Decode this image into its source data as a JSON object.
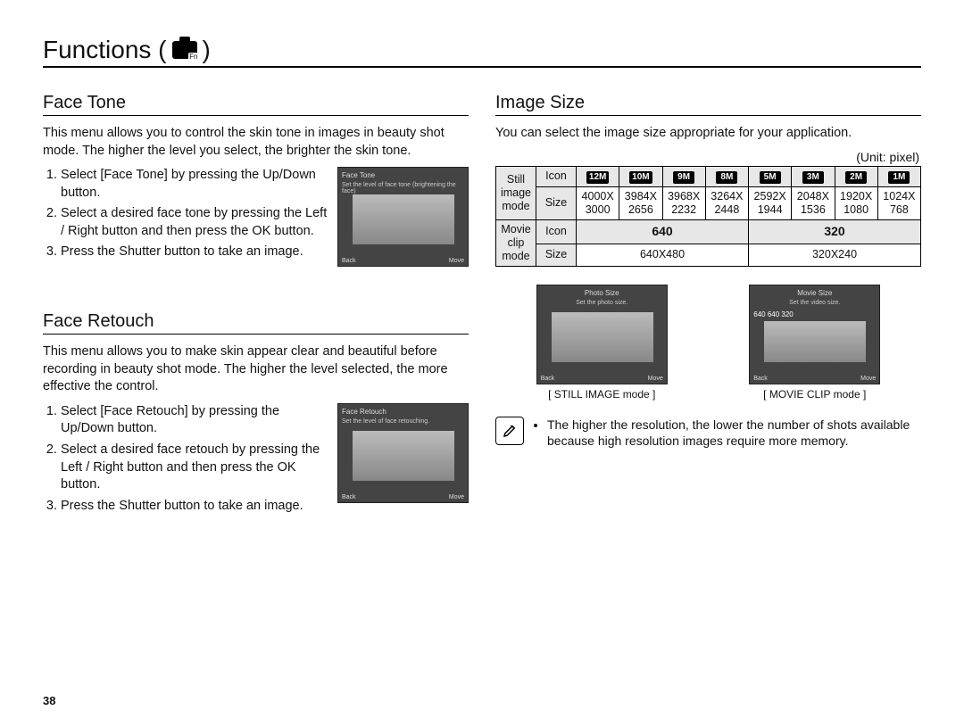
{
  "page_title_prefix": "Functions (",
  "page_title_suffix": " )",
  "page_number": "38",
  "left": {
    "face_tone": {
      "heading": "Face Tone",
      "para": "This menu allows you to control the skin tone in images in beauty shot mode. The higher the level you select, the brighter the skin tone.",
      "steps": [
        "Select [Face Tone] by pressing the Up/Down button.",
        "Select a desired face tone by pressing the Left / Right button and then press the OK button.",
        "Press the Shutter button to take an image."
      ],
      "lcd": {
        "title": "Face Tone",
        "caption": "Set the level of face tone (brightening the face)",
        "back": "Back",
        "move": "Move"
      }
    },
    "face_retouch": {
      "heading": "Face Retouch",
      "para": "This menu allows you to make skin appear clear and beautiful before recording in beauty shot mode. The higher the level selected, the more effective the control.",
      "steps": [
        "Select [Face Retouch] by pressing the Up/Down button.",
        "Select a desired face retouch by pressing the Left / Right button and then press the OK button.",
        "Press the Shutter button to take an image."
      ],
      "lcd": {
        "title": "Face Retouch",
        "caption": "Set the level of face retouching.",
        "back": "Back",
        "move": "Move"
      }
    }
  },
  "right": {
    "heading": "Image Size",
    "para": "You can select the image size appropriate for your application.",
    "unit_label": "(Unit: pixel)",
    "still_label": "Still image mode",
    "movie_label": "Movie clip mode",
    "row_icon_label": "Icon",
    "row_size_label": "Size",
    "still_icons": [
      "12M",
      "10M",
      "9M",
      "8M",
      "5M",
      "3M",
      "2M",
      "1M"
    ],
    "still_sizes": [
      "4000X 3000",
      "3984X 2656",
      "3968X 2232",
      "3264X 2448",
      "2592X 1944",
      "2048X 1536",
      "1920X 1080",
      "1024X 768"
    ],
    "movie_icons": [
      "640",
      "320"
    ],
    "movie_sizes": [
      "640X480",
      "320X240"
    ],
    "fig_still": {
      "title": "Photo Size",
      "caption": "Set the photo size.",
      "back": "Back",
      "move": "Move",
      "label": "[ STILL IMAGE mode ]"
    },
    "fig_movie": {
      "title": "Movie Size",
      "caption": "Set the video size.",
      "options": "640  640  320",
      "back": "Back",
      "move": "Move",
      "label": "[ MOVIE CLIP mode ]"
    },
    "note": "The higher the resolution, the lower the number of shots available because high resolution images require more memory."
  }
}
